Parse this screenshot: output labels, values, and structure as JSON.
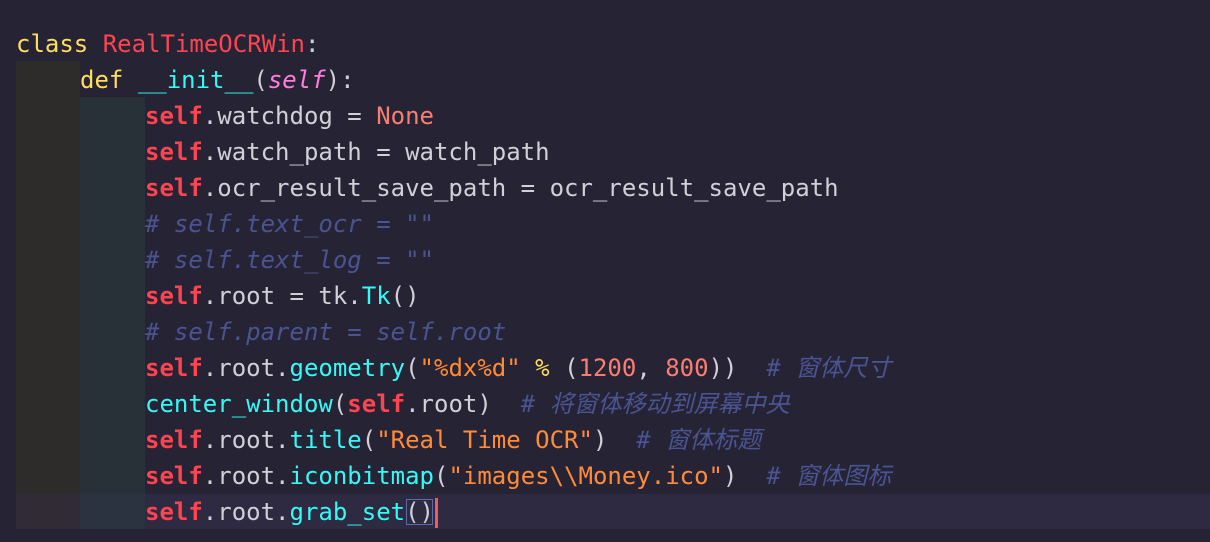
{
  "colors": {
    "background": "#262335",
    "keyword": "#fede5d",
    "class_name": "#fe4450",
    "function": "#36f9f6",
    "self_param": "#ff7edb",
    "string": "#ff8b39",
    "number": "#f97e72",
    "comment": "#4a5491",
    "text": "#d0d0d6"
  },
  "code": {
    "line1": {
      "kw": "class",
      "name": "RealTimeOCRWin",
      "tail": ":"
    },
    "line2": {
      "kw": "def",
      "name": "__init__",
      "open": "(",
      "param": "self",
      "close": "):"
    },
    "line3": {
      "self": "self",
      "rest": ".watchdog = ",
      "value": "None"
    },
    "line4": {
      "self": "self",
      "rest": ".watch_path = watch_path"
    },
    "line5": {
      "self": "self",
      "rest": ".ocr_result_save_path = ocr_result_save_path"
    },
    "line6": {
      "comment": "# self.text_ocr = \"\""
    },
    "line7": {
      "comment": "# self.text_log = \"\""
    },
    "line8": {
      "self": "self",
      "rest": ".root = tk.",
      "method": "Tk",
      "tail": "()"
    },
    "line9": {
      "comment": "# self.parent = self.root"
    },
    "line10": {
      "self": "self",
      "rest": ".root.",
      "method": "geometry",
      "open": "(",
      "string": "\"%dx%d\"",
      "op": " % ",
      "open2": "(",
      "n1": "1200",
      "comma": ", ",
      "n2": "800",
      "close": "))",
      "comment": "  # 窗体尺寸"
    },
    "line11": {
      "fn": "center_window",
      "open": "(",
      "self": "self",
      "rest": ".root)",
      "comment": "  # 将窗体移动到屏幕中央"
    },
    "line12": {
      "self": "self",
      "rest": ".root.",
      "method": "title",
      "open": "(",
      "string": "\"Real Time OCR\"",
      "close": ")",
      "comment": "  # 窗体标题"
    },
    "line13": {
      "self": "self",
      "rest": ".root.",
      "method": "iconbitmap",
      "open": "(",
      "string": "\"images\\\\Money.ico\"",
      "close": ")",
      "comment": "  # 窗体图标"
    },
    "line14": {
      "self": "self",
      "rest": ".root.",
      "method": "grab_set",
      "parens": "()"
    }
  }
}
